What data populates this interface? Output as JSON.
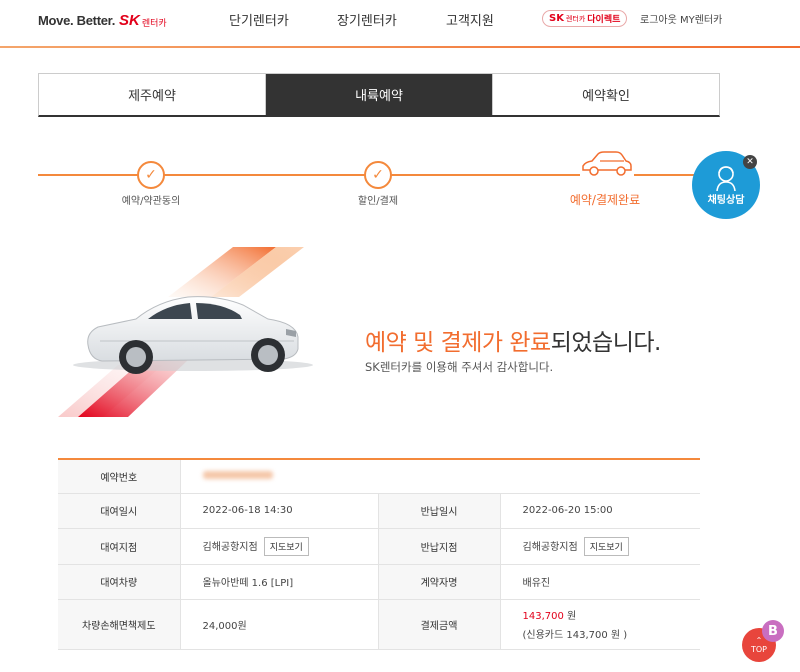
{
  "header": {
    "logo_text": "Move. Better.",
    "logo_sk": "SK",
    "logo_sub": "렌터카",
    "nav": [
      "단기렌터카",
      "장기렌터카",
      "고객지원"
    ],
    "direct_sk": "SK",
    "direct_sub": "렌터카",
    "direct_label": "다이렉트",
    "logout": "로그아웃",
    "my": "MY렌터카"
  },
  "tabs": [
    {
      "label": "제주예약",
      "active": false
    },
    {
      "label": "내륙예약",
      "active": true
    },
    {
      "label": "예약확인",
      "active": false
    }
  ],
  "steps": [
    {
      "label": "예약/약관동의",
      "done": true
    },
    {
      "label": "할인/결제",
      "done": true
    },
    {
      "label": "예약/결제완료",
      "current": true
    }
  ],
  "chat": {
    "label": "채팅상담"
  },
  "completion": {
    "title_highlight": "예약 및 결제가 완료",
    "title_rest": "되었습니다.",
    "subtitle": "SK렌터카를 이용해 주셔서 감사합니다."
  },
  "reservation": {
    "number_label": "예약번호",
    "rental_date_label": "대여일시",
    "rental_date": "2022-06-18 14:30",
    "return_date_label": "반납일시",
    "return_date": "2022-06-20 15:00",
    "rental_branch_label": "대여지점",
    "rental_branch": "김해공항지점",
    "return_branch_label": "반납지점",
    "return_branch": "김해공항지점",
    "map_button": "지도보기",
    "vehicle_label": "대여차량",
    "vehicle": "올뉴아반떼 1.6 [LPI]",
    "contractor_label": "계약자명",
    "contractor": "배유진",
    "insurance_label": "차량손해면책제도",
    "insurance": "24,000원",
    "payment_label": "결제금액",
    "payment_amount": "143,700",
    "payment_unit": " 원",
    "payment_detail": "(신용카드 143,700 원 )"
  },
  "top_button": {
    "label": "TOP"
  },
  "badge": {
    "label": "B"
  },
  "colors": {
    "accent": "#f26d2f",
    "brand_red": "#e2001a",
    "chat_blue": "#1e9bd7",
    "dark_tab": "#333333"
  }
}
